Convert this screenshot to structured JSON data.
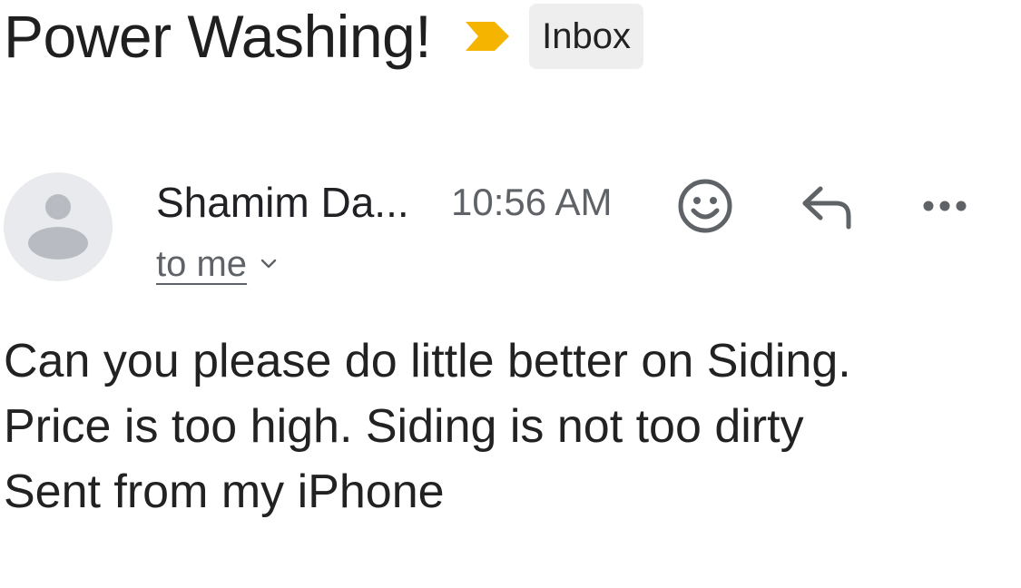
{
  "message": {
    "subject": "Power Washing!",
    "label": "Inbox",
    "sender": "Shamim Da...",
    "time": "10:56 AM",
    "recipient": "to me",
    "body_lines": [
      "Can you please do little better on Siding.",
      "Price is too high. Siding is not too dirty",
      "Sent from my iPhone"
    ]
  },
  "icons": {
    "importance": "importance-marker-icon",
    "avatar": "person-avatar-icon",
    "recipient_details": "chevron-down-icon",
    "emoji": "emoji-smile-icon",
    "reply": "reply-icon",
    "more": "more-horizontal-icon"
  },
  "colors": {
    "importance": "#F4B400",
    "label_chip_bg": "#EEEEEE",
    "secondary_text": "#5F6368",
    "avatar_bg": "#E9EAEE",
    "avatar_figure": "#B8BBC2"
  }
}
